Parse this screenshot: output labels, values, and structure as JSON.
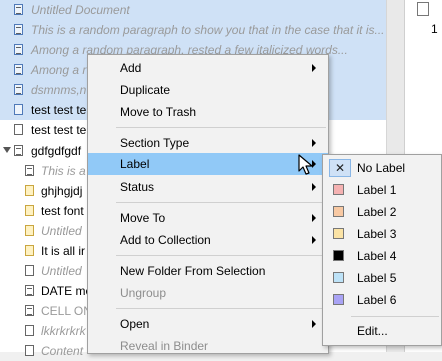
{
  "binder": {
    "items": [
      {
        "text": "Untitled Document",
        "style": "italic",
        "icon": "document-icon"
      },
      {
        "text": "This is a random paragraph to show you that in the case that it is...",
        "style": "italic",
        "icon": "document-icon"
      },
      {
        "text": "Among a random paragraph, rested a few italicized words...",
        "style": "italic",
        "icon": "document-icon"
      },
      {
        "text": "Among a r",
        "style": "italic",
        "icon": "document-icon"
      },
      {
        "text": "dsmnms,n",
        "style": "italic",
        "icon": "document-icon"
      },
      {
        "text": "test test te",
        "style": "normal",
        "icon": "document-icon"
      },
      {
        "text": "test test te",
        "style": "normal",
        "icon": "document-icon"
      },
      {
        "text": "gdfgdfgdf",
        "style": "normal",
        "icon": "folder-icon"
      },
      {
        "text": "This is a",
        "style": "italic",
        "icon": "document-icon"
      },
      {
        "text": "ghjhgjdj",
        "style": "normal",
        "icon": "document-icon"
      },
      {
        "text": "test font",
        "style": "normal",
        "icon": "document-icon"
      },
      {
        "text": "Untitled",
        "style": "italic",
        "icon": "document-icon"
      },
      {
        "text": "It is all ir",
        "style": "normal",
        "icon": "document-icon"
      },
      {
        "text": "Untitled",
        "style": "italic",
        "icon": "document-icon"
      },
      {
        "text": "DATE me",
        "style": "normal",
        "icon": "document-icon"
      },
      {
        "text": "CELL ON",
        "style": "gray",
        "icon": "document-icon"
      },
      {
        "text": "lkkrkrkrk",
        "style": "italic",
        "icon": "document-icon"
      },
      {
        "text": "Content",
        "style": "italic",
        "icon": "document-icon"
      }
    ]
  },
  "right_pane": {
    "digit": "1"
  },
  "context_menu": {
    "items": [
      {
        "label": "Add",
        "submenu": true
      },
      {
        "label": "Duplicate",
        "submenu": false
      },
      {
        "label": "Move to Trash",
        "submenu": false
      },
      {
        "label": "Section Type",
        "submenu": true
      },
      {
        "label": "Label",
        "submenu": true
      },
      {
        "label": "Status",
        "submenu": true
      },
      {
        "label": "Move To",
        "submenu": true
      },
      {
        "label": "Add to Collection",
        "submenu": true
      },
      {
        "label": "New Folder From Selection",
        "submenu": false
      },
      {
        "label": "Ungroup",
        "submenu": false
      },
      {
        "label": "Open",
        "submenu": true
      },
      {
        "label": "Reveal in Binder",
        "submenu": false
      }
    ]
  },
  "label_submenu": {
    "check_mark": "✕",
    "no_label": "No Label",
    "labels": [
      {
        "name": "Label 1",
        "color": "#f5b2b2"
      },
      {
        "name": "Label 2",
        "color": "#f8c9a3"
      },
      {
        "name": "Label 3",
        "color": "#fbe3a5"
      },
      {
        "name": "Label 4",
        "color": "#000000"
      },
      {
        "name": "Label 5",
        "color": "#bde2f7"
      },
      {
        "name": "Label 6",
        "color": "#a9a3f5"
      }
    ],
    "edit": "Edit..."
  },
  "colors": {
    "highlight": "#91c9f7",
    "selection": "#cfe1f6",
    "menu_bg": "#f2f2f2"
  }
}
